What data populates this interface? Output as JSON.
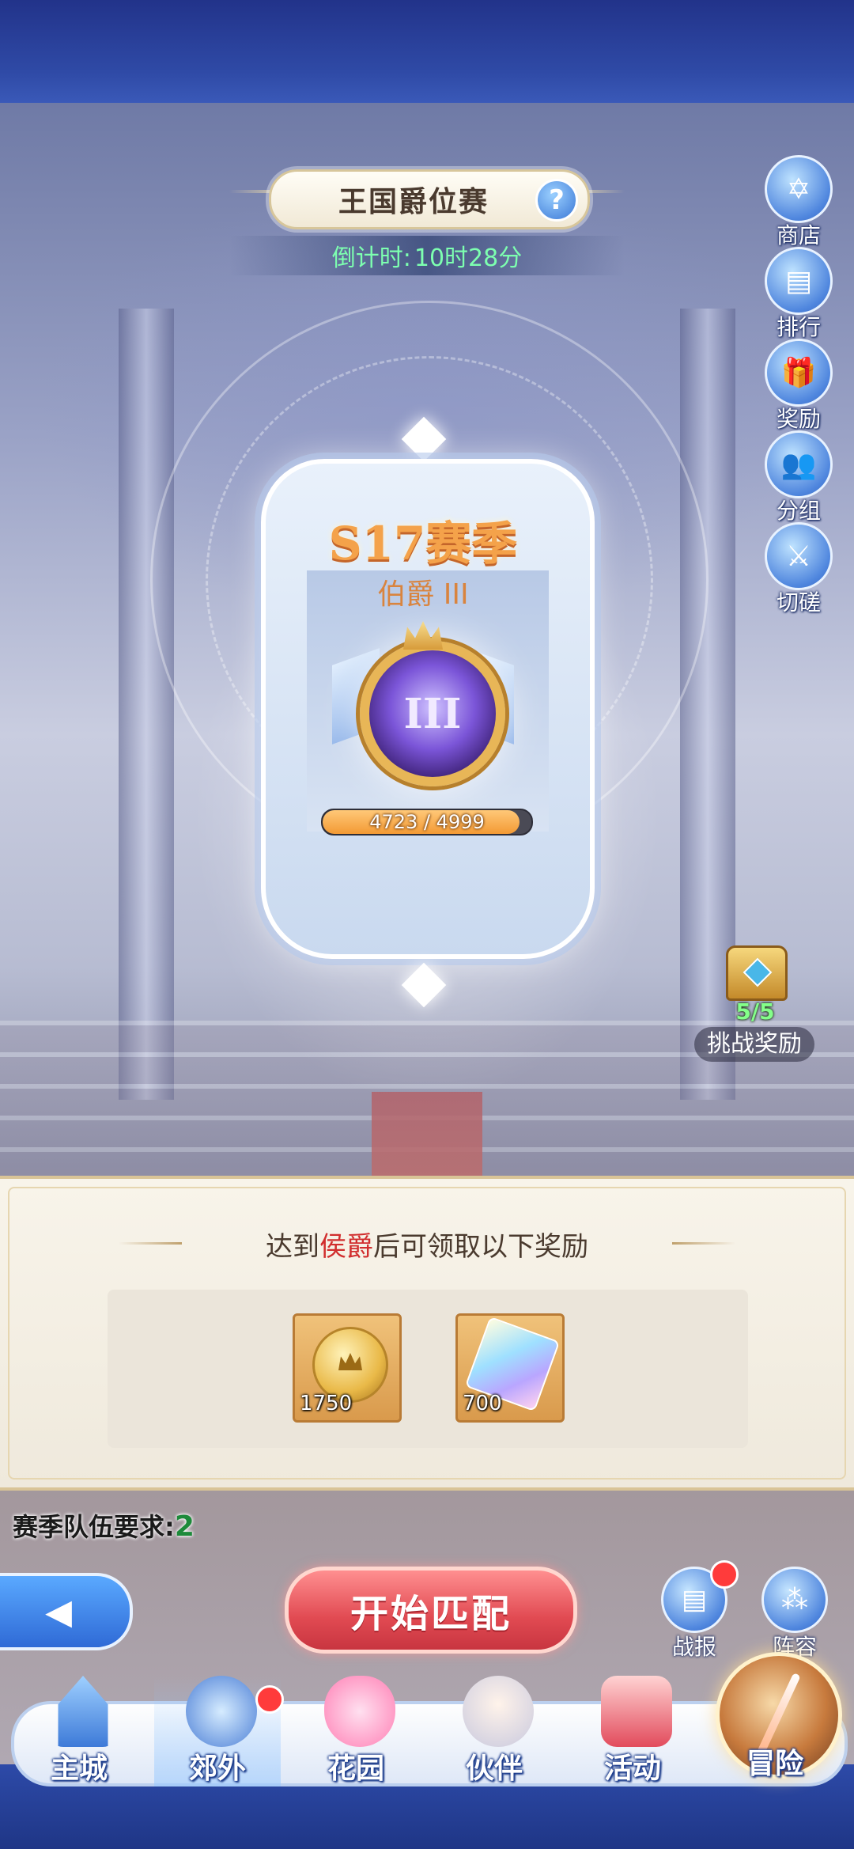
{
  "header": {
    "title": "王国爵位赛",
    "help_icon": "?",
    "countdown_label": "倒计时:",
    "countdown_value": "10时28分"
  },
  "side_menu": [
    {
      "label": "商店",
      "icon": "shop-icon",
      "glyph": "✡"
    },
    {
      "label": "排行",
      "icon": "ranking-icon",
      "glyph": "▤"
    },
    {
      "label": "奖励",
      "icon": "gift-icon",
      "glyph": "🎁"
    },
    {
      "label": "分组",
      "icon": "group-icon",
      "glyph": "👥"
    },
    {
      "label": "切磋",
      "icon": "crossed-swords-icon",
      "glyph": "⚔"
    }
  ],
  "rank_card": {
    "season": "S17赛季",
    "rank": "伯爵 III",
    "emblem_numeral": "III",
    "progress_text": "4723 / 4999",
    "progress_fraction": 0.945
  },
  "challenge_reward": {
    "count": "5/5",
    "label": "挑战奖励"
  },
  "reward_panel": {
    "title_prefix": "达到",
    "title_highlight": "侯爵",
    "title_suffix": "后可领取以下奖励",
    "items": [
      {
        "icon": "crown-coin-icon",
        "quantity": "1750"
      },
      {
        "icon": "crystal-icon",
        "quantity": "700"
      }
    ]
  },
  "team_requirement": {
    "label": "赛季队伍要求:",
    "value": "2"
  },
  "actions": {
    "back_glyph": "◀",
    "match_label": "开始匹配",
    "battle_report_label": "战报",
    "battle_report_glyph": "▤",
    "formation_label": "阵容",
    "formation_glyph": "⁂"
  },
  "bottom_nav": [
    {
      "label": "主城",
      "icon": "castle-icon",
      "active": false
    },
    {
      "label": "郊外",
      "icon": "outskirts-icon",
      "active": true,
      "badge": true
    },
    {
      "label": "花园",
      "icon": "garden-icon",
      "active": false
    },
    {
      "label": "伙伴",
      "icon": "partner-icon",
      "active": false
    },
    {
      "label": "活动",
      "icon": "gift-box-icon",
      "active": false
    },
    {
      "label": "冒险",
      "icon": "compass-icon",
      "active": false
    }
  ],
  "colors": {
    "countdown": "#7dffb0",
    "highlight_red": "#d12e2e",
    "progress_fill": "#f39a34",
    "match_button": "#e14a52",
    "team_value": "#1d8a3a"
  }
}
